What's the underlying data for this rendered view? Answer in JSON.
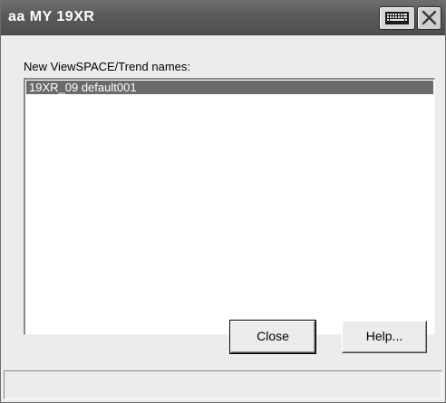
{
  "window": {
    "title": "aa MY 19XR"
  },
  "list": {
    "label": "New ViewSPACE/Trend names:",
    "items": [
      {
        "label": "19XR_09 default001",
        "selected": true
      }
    ]
  },
  "buttons": {
    "close_label": "Close",
    "help_label": "Help..."
  },
  "status": {
    "text": ""
  },
  "icons": {
    "keyboard": "keyboard-icon",
    "close": "close-icon"
  },
  "colors": {
    "titlebar": "#5a5a5a",
    "selection": "#6b6b6b",
    "window_bg": "#ececec"
  }
}
